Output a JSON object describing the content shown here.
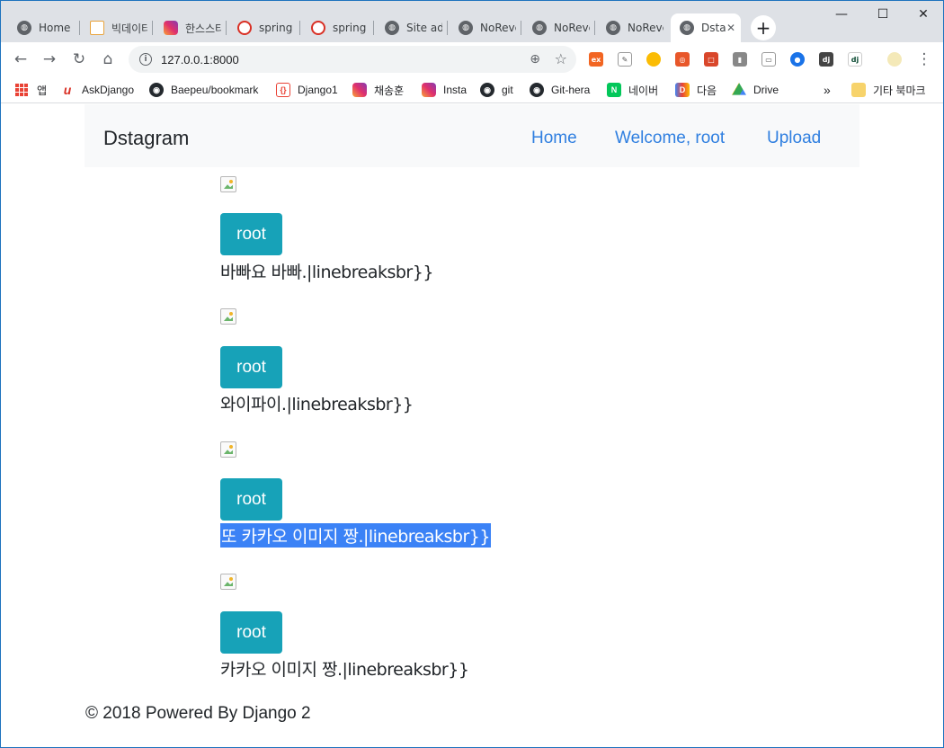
{
  "browser": {
    "tabs": [
      {
        "label": "Home |",
        "icon": "globe-icon"
      },
      {
        "label": "빅데이터",
        "icon": "mail-icon"
      },
      {
        "label": "한스스타",
        "icon": "instagram-icon"
      },
      {
        "label": "spring |",
        "icon": "spring-icon"
      },
      {
        "label": "spring |",
        "icon": "spring-icon"
      },
      {
        "label": "Site adm",
        "icon": "globe-icon"
      },
      {
        "label": "NoReve",
        "icon": "globe-icon"
      },
      {
        "label": "NoReve",
        "icon": "globe-icon"
      },
      {
        "label": "NoReve",
        "icon": "globe-icon"
      },
      {
        "label": "Dsta",
        "icon": "globe-icon",
        "active": true
      }
    ],
    "new_tab": "+",
    "window_controls": {
      "minimize": "—",
      "maximize": "☐",
      "close": "✕"
    },
    "url": "127.0.0.1:8000",
    "bookmarks": [
      {
        "label": "앱",
        "icon": "apps-icon"
      },
      {
        "label": "AskDjango",
        "icon": "askdjango-icon"
      },
      {
        "label": "Baepeu/bookmark",
        "icon": "github-icon"
      },
      {
        "label": "Django1",
        "icon": "bracket-icon"
      },
      {
        "label": "채송훈",
        "icon": "instagram-icon"
      },
      {
        "label": "Insta",
        "icon": "instagram-icon"
      },
      {
        "label": "git",
        "icon": "github-icon"
      },
      {
        "label": "Git-hera",
        "icon": "github-icon"
      },
      {
        "label": "네이버",
        "icon": "naver-icon"
      },
      {
        "label": "다음",
        "icon": "daum-icon"
      },
      {
        "label": "Drive",
        "icon": "drive-icon"
      }
    ],
    "bookmarks_more": "»",
    "other_bookmarks": "기타 북마크"
  },
  "site": {
    "brand": "Dstagram",
    "nav": [
      {
        "label": "Home"
      },
      {
        "label": "Welcome, root"
      },
      {
        "label": "Upload"
      }
    ],
    "posts": [
      {
        "author": "root",
        "text": "바빠요 바빠.|linebreaksbr}}",
        "selected": false
      },
      {
        "author": "root",
        "text": "와이파이.|linebreaksbr}}",
        "selected": false
      },
      {
        "author": "root",
        "text": "또 카카오 이미지 짱.|linebreaksbr}}",
        "selected": true
      },
      {
        "author": "root",
        "text": "카카오 이미지 짱.|linebreaksbr}}",
        "selected": false
      }
    ],
    "footer": "© 2018 Powered By Django 2"
  },
  "colors": {
    "accent_link": "#2f7fe0",
    "author_button": "#17a2b8",
    "selection": "#3b82f6",
    "navbar_bg": "#f8f9fa"
  }
}
